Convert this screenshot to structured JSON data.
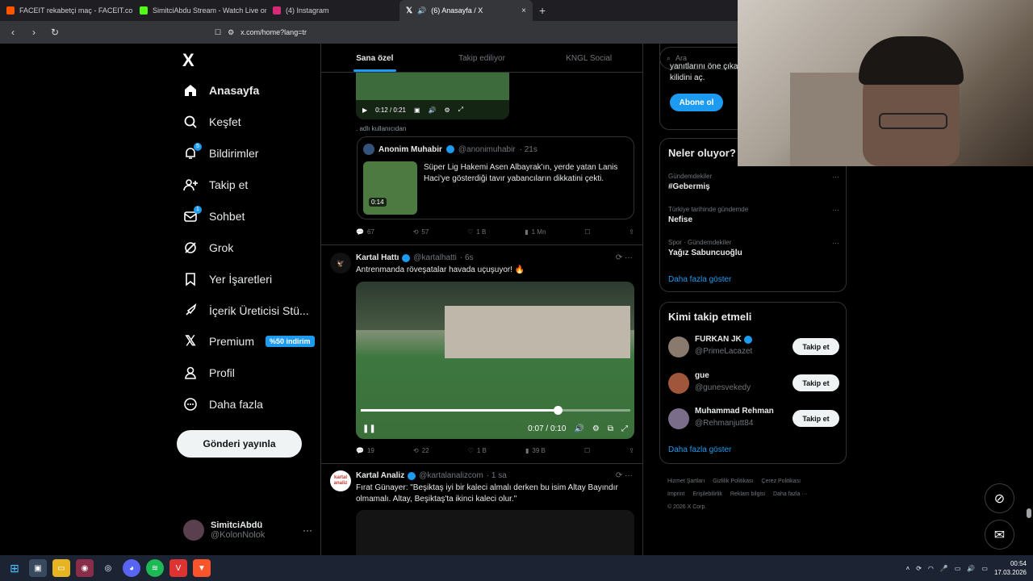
{
  "browser": {
    "tabs": [
      {
        "title": "FACEIT rekabetçi maç - FACEIT.com",
        "color": "#ff5500"
      },
      {
        "title": "SimitciAbdu Stream - Watch Live on",
        "color": "#53fc18"
      },
      {
        "title": "(4) Instagram",
        "color": "#d62976"
      },
      {
        "title": "(6) Anasayfa / X",
        "color": "#ffffff",
        "active": true
      }
    ],
    "new_tab": "+",
    "close_glyph": "×",
    "url": "x.com/home?lang=tr"
  },
  "nav": {
    "logo": "X",
    "items": [
      {
        "label": "Anasayfa",
        "icon": "home-icon"
      },
      {
        "label": "Keşfet",
        "icon": "search-icon"
      },
      {
        "label": "Bildirimler",
        "icon": "bell-icon",
        "badge": "5"
      },
      {
        "label": "Takip et",
        "icon": "add-user-icon"
      },
      {
        "label": "Sohbet",
        "icon": "mail-icon",
        "badge": "1"
      },
      {
        "label": "Grok",
        "icon": "grok-icon"
      },
      {
        "label": "Yer İşaretleri",
        "icon": "bookmark-icon"
      },
      {
        "label": "İçerik Üreticisi Stü...",
        "icon": "rocket-icon"
      },
      {
        "label": "Premium",
        "icon": "x-icon",
        "promo": "%50 indirim"
      },
      {
        "label": "Profil",
        "icon": "profile-icon"
      },
      {
        "label": "Daha fazla",
        "icon": "more-circle-icon"
      }
    ],
    "post_button": "Gönderi yayınla",
    "account": {
      "name": "SimitciAbdü",
      "handle": "@KolonNolok",
      "more": "···"
    }
  },
  "feed": {
    "tabs": [
      "Sana özel",
      "Takip ediliyor",
      "KNGL Social"
    ],
    "top_video": {
      "time": "0:12 / 0:21"
    },
    "attribution": ". adlı kullanıcıdan",
    "quote": {
      "name": "Anonim Muhabir",
      "handle": "@anonimuhabir",
      "age": "· 21s",
      "text": "Süper Lig Hakemi Asen Albayrak'ın, yerde yatan Lanis Haci'ye gösterdiği tavır yabancıların dikkatini çekti.",
      "thumb_time": "0:14"
    },
    "actions1": {
      "replies": "67",
      "reposts": "57",
      "likes": "1 B",
      "views": "1 Mn"
    },
    "tweet2": {
      "name": "Kartal Hattı",
      "handle": "@kartalhatti",
      "age": "· 6s",
      "text": "Antrenmanda röveşatalar havada uçuşuyor! 🔥",
      "video_time": "0:07 / 0:10",
      "progress": 0.73,
      "actions": {
        "replies": "19",
        "reposts": "22",
        "likes": "1 B",
        "views": "39 B"
      }
    },
    "tweet3": {
      "name": "Kartal Analiz",
      "handle": "@kartalanalizcom",
      "age": "· 1 sa",
      "avatar_text": "kartal analiz",
      "text": "Fırat Günayer: \"Beşiktaş iyi bir kaleci almalı derken bu isim Altay Bayındır olmamalı. Altay, Beşiktaş'ta ikinci kaleci olur.\""
    }
  },
  "right": {
    "search_placeholder": "Ara",
    "premium_text_1": "yanıtlarını öne çıka",
    "premium_text_2": "kilidini aç.",
    "subscribe": "Abone ol",
    "trends_title": "Neler oluyor?",
    "trends": [
      {
        "context": "Gündemdekiler",
        "name": "#Gebermiş"
      },
      {
        "context": "Türkiye tarihinde gündemde",
        "name": "Nefise"
      },
      {
        "context": "Spor · Gündemdekiler",
        "name": "Yağız Sabuncuoğlu"
      }
    ],
    "show_more": "Daha fazla göster",
    "follow_title": "Kimi takip etmeli",
    "follow": [
      {
        "name": "FURKAN JK",
        "handle": "@PrimeLacazet",
        "verified": true
      },
      {
        "name": "gue",
        "handle": "@gunesvekedy",
        "verified": false
      },
      {
        "name": "Muhammad Rehman",
        "handle": "@Rehmanjutt84",
        "verified": false
      }
    ],
    "follow_btn": "Takip et",
    "footer": [
      "Hizmet Şartları",
      "Gizlilik Politikası",
      "Çerez Politikası",
      "Imprint",
      "Erişilebilirlik",
      "Reklam bilgisi",
      "Daha fazla ···",
      "© 2026 X Corp."
    ]
  },
  "taskbar": {
    "time": "00:54",
    "date": "17.03.2026"
  }
}
